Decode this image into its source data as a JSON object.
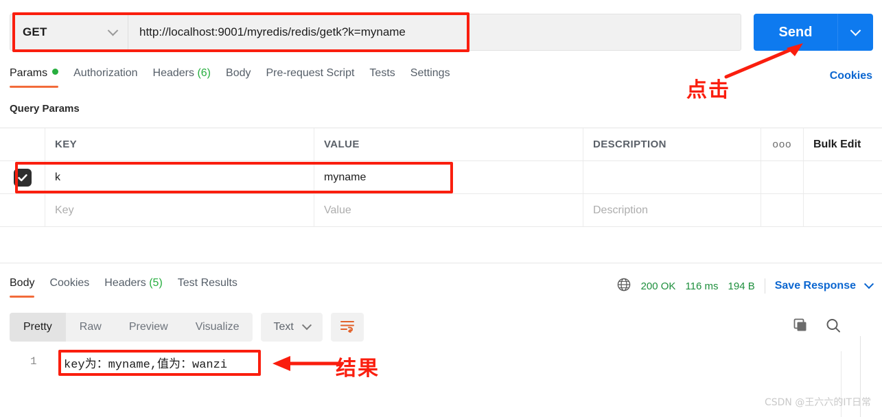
{
  "request": {
    "method": "GET",
    "url": "http://localhost:9001/myredis/redis/getk?k=myname",
    "send_label": "Send",
    "send_caret_icon": "chevron-down-icon",
    "method_caret_icon": "chevron-down-icon"
  },
  "request_tabs": [
    {
      "label": "Params",
      "badge": "",
      "badge_type": "dot",
      "active": true
    },
    {
      "label": "Authorization",
      "badge": "",
      "badge_type": "",
      "active": false
    },
    {
      "label": "Headers",
      "badge": "(6)",
      "badge_type": "count",
      "active": false
    },
    {
      "label": "Body",
      "badge": "",
      "badge_type": "",
      "active": false
    },
    {
      "label": "Pre-request Script",
      "badge": "",
      "badge_type": "",
      "active": false
    },
    {
      "label": "Tests",
      "badge": "",
      "badge_type": "",
      "active": false
    },
    {
      "label": "Settings",
      "badge": "",
      "badge_type": "",
      "active": false
    }
  ],
  "cookies_link": "Cookies",
  "params": {
    "section_title": "Query Params",
    "columns": [
      "KEY",
      "VALUE",
      "DESCRIPTION"
    ],
    "more_icon": "ooo",
    "bulk_edit_label": "Bulk Edit",
    "rows": [
      {
        "checked": true,
        "key": "k",
        "value": "myname",
        "description": ""
      }
    ],
    "placeholder_row": {
      "key": "Key",
      "value": "Value",
      "description": "Description"
    }
  },
  "response_tabs": [
    {
      "label": "Body",
      "badge": "",
      "active": true
    },
    {
      "label": "Cookies",
      "badge": "",
      "active": false
    },
    {
      "label": "Headers",
      "badge": "(5)",
      "active": false
    },
    {
      "label": "Test Results",
      "badge": "",
      "active": false
    }
  ],
  "status": {
    "globe_icon": "globe-icon",
    "code": "200 OK",
    "time": "116 ms",
    "size": "194 B",
    "save_response_label": "Save Response",
    "save_caret_icon": "chevron-down-icon"
  },
  "body_toolbar": {
    "views": [
      "Pretty",
      "Raw",
      "Preview",
      "Visualize"
    ],
    "active_view": "Pretty",
    "format": "Text",
    "format_caret_icon": "chevron-down-icon",
    "wrap_icon": "wrap-text-icon",
    "copy_icon": "copy-icon",
    "search_icon": "search-icon"
  },
  "response_body": {
    "line_number": "1",
    "line_text": "key为：myname,值为：wanzi"
  },
  "annotations": [
    {
      "name": "click-label",
      "text": "点击",
      "color": "#fa1e0e"
    },
    {
      "name": "result-label",
      "text": "结果",
      "color": "#fa1e0e"
    }
  ],
  "watermark": "CSDN @王六六的IT日常",
  "colors": {
    "accent_blue": "#0e7aef",
    "tab_underline": "#f26b3a",
    "success_green": "#1e8f3d",
    "annotation_red": "#fa1e0e",
    "link_blue": "#0b66d0"
  }
}
